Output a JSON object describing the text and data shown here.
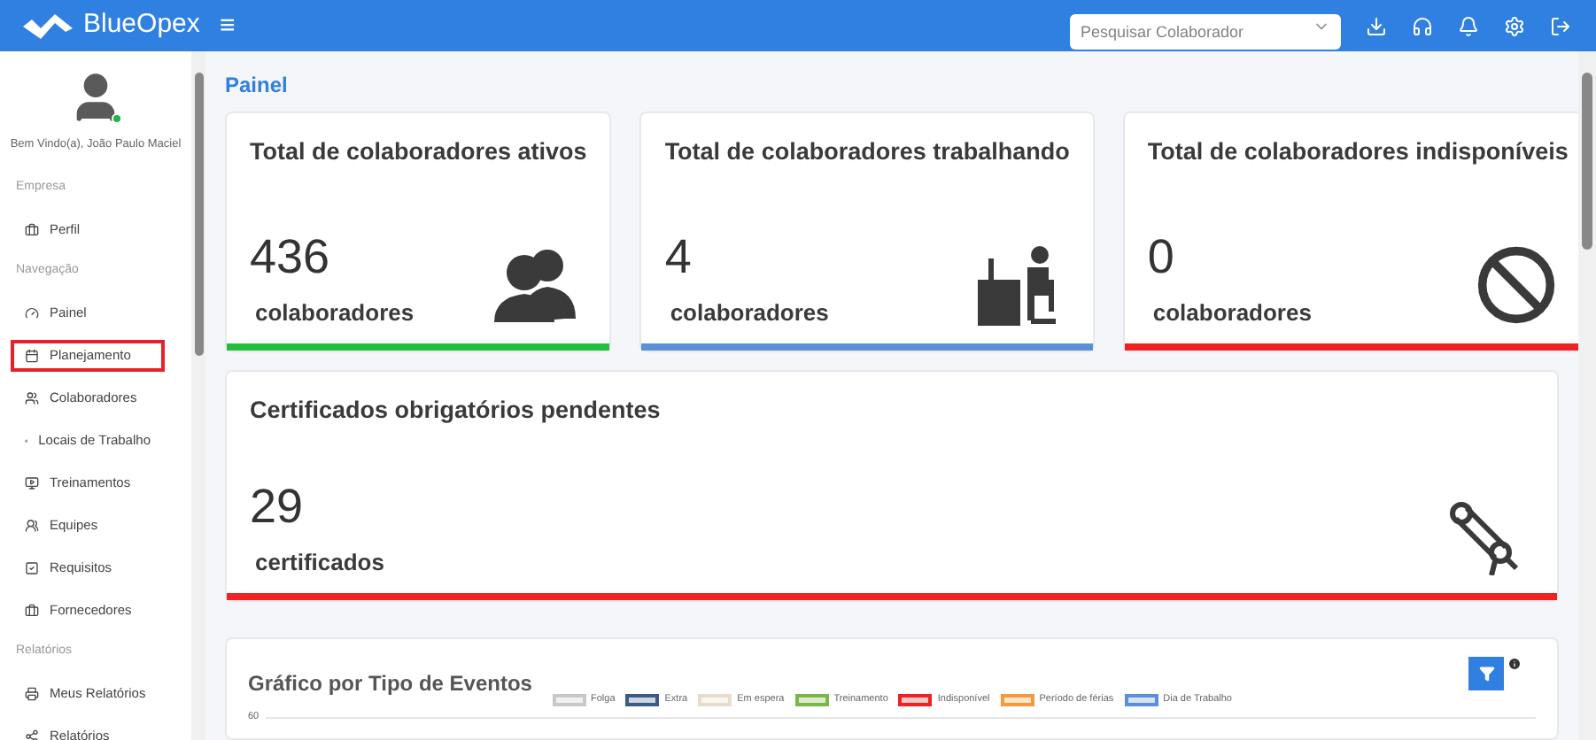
{
  "header": {
    "brand": "BlueOpex",
    "menu_glyph": "≡",
    "search": {
      "placeholder": "Pesquisar Colaborador"
    }
  },
  "sidebar": {
    "user": {
      "greeting": "Bem Vindo(a), João Paulo Maciel",
      "online": true
    },
    "sections": [
      {
        "heading": "Empresa",
        "items": [
          {
            "label": "Perfil",
            "highlighted": false
          }
        ]
      },
      {
        "heading": "Navegação",
        "items": [
          {
            "label": "Painel",
            "highlighted": false
          },
          {
            "label": "Planejamento",
            "highlighted": true
          },
          {
            "label": "Colaboradores",
            "highlighted": false
          },
          {
            "label": "Locais de Trabalho",
            "highlighted": false
          },
          {
            "label": "Treinamentos",
            "highlighted": false
          },
          {
            "label": "Equipes",
            "highlighted": false
          },
          {
            "label": "Requisitos",
            "highlighted": false
          },
          {
            "label": "Fornecedores",
            "highlighted": false
          }
        ]
      },
      {
        "heading": "Relatórios",
        "items": [
          {
            "label": "Meus Relatórios",
            "highlighted": false
          },
          {
            "label": "Relatórios",
            "highlighted": false
          }
        ]
      }
    ]
  },
  "page_title": "Painel",
  "stat_cards": [
    {
      "kind": "people",
      "title": "Total de colaboradores ativos",
      "value": "436",
      "unit": "colaboradores",
      "color": "#22c03c"
    },
    {
      "kind": "desk",
      "title": "Total de colaboradores trabalhando",
      "value": "4",
      "unit": "colaboradores",
      "color": "#5b8fd9"
    },
    {
      "kind": "blocked",
      "title": "Total de colaboradores indisponíveis",
      "value": "0",
      "unit": "colaboradores",
      "color": "#ee2222"
    },
    {
      "kind": "diploma",
      "title": "Certificados obrigatórios pendentes",
      "value": "29",
      "unit": "certificados",
      "color": "#ee2222"
    }
  ],
  "chart_panel": {
    "title": "Gráfico por Tipo de Eventos",
    "top_tick": "60",
    "legend": [
      {
        "label": "Folga",
        "color": "#c8c8c8"
      },
      {
        "label": "Extra",
        "color": "#3b5a8a"
      },
      {
        "label": "Em espera",
        "color": "#e8dccb"
      },
      {
        "label": "Treinamento",
        "color": "#7ab648"
      },
      {
        "label": "Indisponível",
        "color": "#ee2222"
      },
      {
        "label": "Período de férias",
        "color": "#f59a3c"
      },
      {
        "label": "Dia de Trabalho",
        "color": "#5b8fd9"
      }
    ]
  }
}
